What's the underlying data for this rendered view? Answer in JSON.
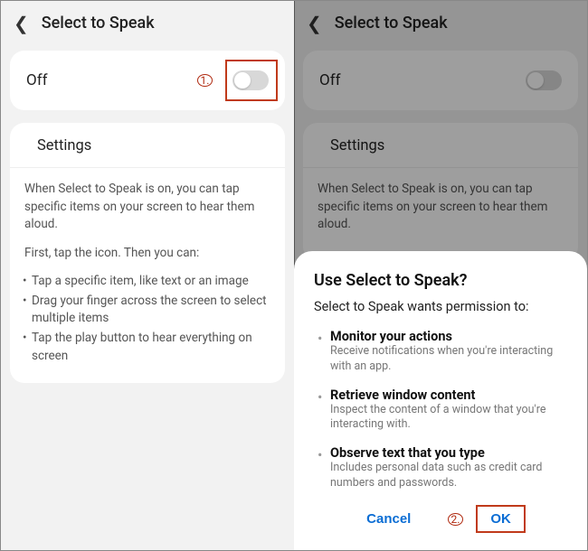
{
  "left": {
    "header": {
      "title": "Select to Speak"
    },
    "toggle": {
      "label": "Off",
      "callout": "1."
    },
    "settings_heading": "Settings",
    "desc_p1": "When Select to Speak is on, you can tap specific items on your screen to hear them aloud.",
    "desc_p2": "First, tap the icon. Then you can:",
    "bullets": [
      "Tap a specific item, like text or an image",
      "Drag your finger across the screen to select multiple items",
      "Tap the play button to hear everything on screen"
    ]
  },
  "right": {
    "header": {
      "title": "Select to Speak"
    },
    "toggle": {
      "label": "Off"
    },
    "settings_heading": "Settings",
    "desc_p1": "When Select to Speak is on, you can tap specific items on your screen to hear them aloud.",
    "dialog": {
      "title": "Use Select to Speak?",
      "subtitle": "Select to Speak wants permission to:",
      "perms": [
        {
          "title": "Monitor your actions",
          "desc": "Receive notifications when you're interacting with an app."
        },
        {
          "title": "Retrieve window content",
          "desc": "Inspect the content of a window that you're interacting with."
        },
        {
          "title": "Observe text that you type",
          "desc": "Includes personal data such as credit card numbers and passwords."
        }
      ],
      "cancel": "Cancel",
      "ok": "OK",
      "callout": "2."
    }
  }
}
